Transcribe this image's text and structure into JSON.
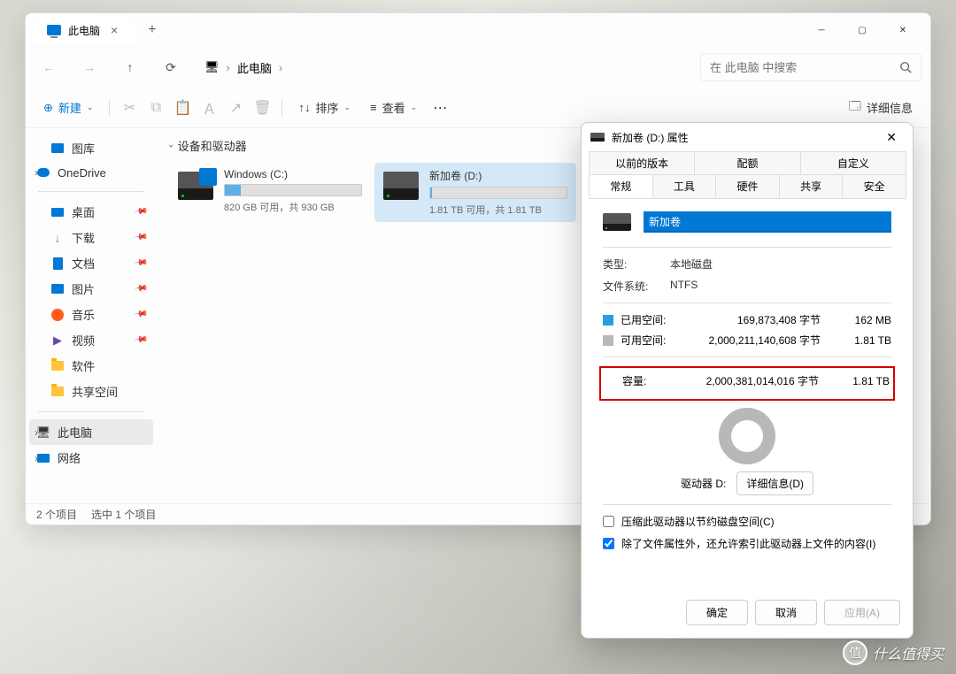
{
  "window": {
    "tab_title": "此电脑",
    "new_tab": "+",
    "tab_close": "×",
    "breadcrumb": {
      "root": "此电脑",
      "sep": "›"
    },
    "search_placeholder": "在 此电脑 中搜索"
  },
  "toolbar": {
    "new": "新建",
    "sort": "排序",
    "view": "查看",
    "details": "详细信息"
  },
  "sidebar": {
    "gallery": "图库",
    "onedrive": "OneDrive",
    "desktop": "桌面",
    "downloads": "下载",
    "documents": "文档",
    "pictures": "图片",
    "music": "音乐",
    "videos": "视频",
    "software": "软件",
    "shared": "共享空间",
    "this_pc": "此电脑",
    "network": "网络"
  },
  "main": {
    "section": "设备和驱动器",
    "drives": [
      {
        "name": "Windows (C:)",
        "status": "820 GB 可用，共 930 GB",
        "fill_pct": 12
      },
      {
        "name": "新加卷 (D:)",
        "status": "1.81 TB 可用，共 1.81 TB",
        "fill_pct": 1
      }
    ]
  },
  "status": {
    "items": "2 个项目",
    "selected": "选中 1 个项目"
  },
  "props": {
    "title": "新加卷 (D:) 属性",
    "tabs_top": [
      "以前的版本",
      "配额",
      "自定义"
    ],
    "tabs_bottom": [
      "常规",
      "工具",
      "硬件",
      "共享",
      "安全"
    ],
    "name_value": "新加卷",
    "type_label": "类型:",
    "type_value": "本地磁盘",
    "fs_label": "文件系统:",
    "fs_value": "NTFS",
    "used_label": "已用空间:",
    "used_bytes": "169,873,408 字节",
    "used_size": "162 MB",
    "free_label": "可用空间:",
    "free_bytes": "2,000,211,140,608 字节",
    "free_size": "1.81 TB",
    "capacity_label": "容量:",
    "capacity_bytes": "2,000,381,014,016 字节",
    "capacity_size": "1.81 TB",
    "drive_label": "驱动器 D:",
    "details_btn": "详细信息(D)",
    "compress_label": "压缩此驱动器以节约磁盘空间(C)",
    "index_label": "除了文件属性外，还允许索引此驱动器上文件的内容(I)",
    "ok": "确定",
    "cancel": "取消",
    "apply": "应用(A)"
  },
  "watermark": {
    "badge": "值",
    "text": "什么值得买"
  },
  "colors": {
    "accent": "#0078d4",
    "used": "#26a0da",
    "free": "#b8b8b8",
    "highlight_border": "#d60000"
  }
}
